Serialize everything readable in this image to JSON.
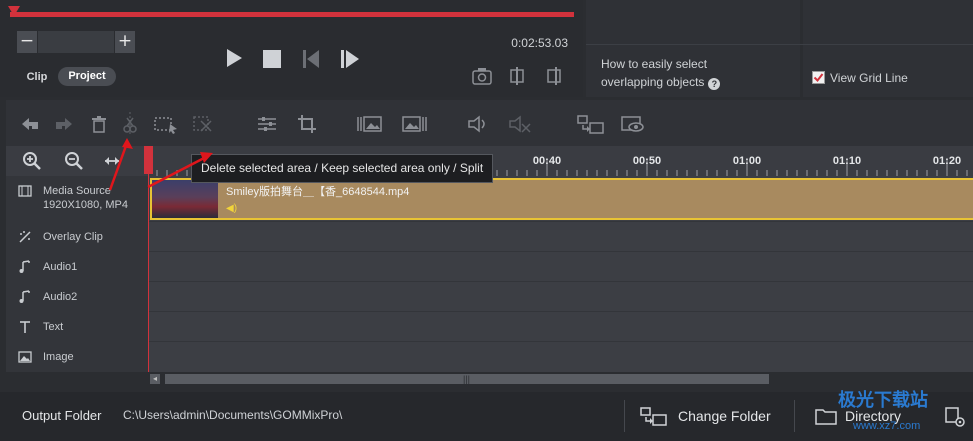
{
  "preview": {
    "zoom_minus": "−",
    "zoom_plus": "+",
    "time_display": "0:02:53.03",
    "tabs": [
      {
        "label": "Clip",
        "active": false
      },
      {
        "label": "Project",
        "active": true
      }
    ],
    "playback_progress": 0.0
  },
  "help_panel": {
    "tip_line1": "How to easily select",
    "tip_line2": "overlapping objects",
    "help_glyph": "?",
    "grid_checkbox_label": "View Grid Line",
    "grid_checked": true
  },
  "toolbar": {
    "icons": [
      "undo-icon",
      "redo-icon",
      "delete-icon",
      "split-icon",
      "select-area-icon",
      "keep-area-icon",
      "adjust-icon",
      "crop-icon",
      "image-left-icon",
      "image-right-icon",
      "volume-icon",
      "mute-icon",
      "replace-clip-icon",
      "preview-icon"
    ]
  },
  "tooltip": {
    "text": "Delete selected area / Keep selected area only / Split"
  },
  "timeline": {
    "zoom_in": "⊕",
    "zoom_out": "⊖",
    "ruler_labels": [
      "00:40",
      "00:50",
      "01:00",
      "01:10",
      "01:20"
    ],
    "tracks": [
      {
        "name": "Media Source",
        "sub": "1920X1080, MP4",
        "icon": "film-icon"
      },
      {
        "name": "Overlay Clip",
        "icon": "overlay-icon"
      },
      {
        "name": "Audio1",
        "icon": "music-icon"
      },
      {
        "name": "Audio2",
        "icon": "music-icon"
      },
      {
        "name": "Text",
        "icon": "text-icon"
      },
      {
        "name": "Image",
        "icon": "image-icon"
      }
    ],
    "clip": {
      "name": "Smiley版拍舞台＿【香_6648544.mp4",
      "audio_glyph": "◀)"
    },
    "scroll_left": "◂",
    "scroll_grip": "|||"
  },
  "bottom": {
    "output_label": "Output Folder",
    "output_path": "C:\\Users\\admin\\Documents\\GOMMixPro\\",
    "change_folder_label": "Change Folder",
    "directory_label": "Directory"
  },
  "watermark": {
    "text": "极光下载站",
    "url": "www.xz7.com"
  },
  "colors": {
    "accent_red": "#d2323c",
    "clip_fill": "#a88a5f",
    "clip_border": "#e8c334"
  }
}
